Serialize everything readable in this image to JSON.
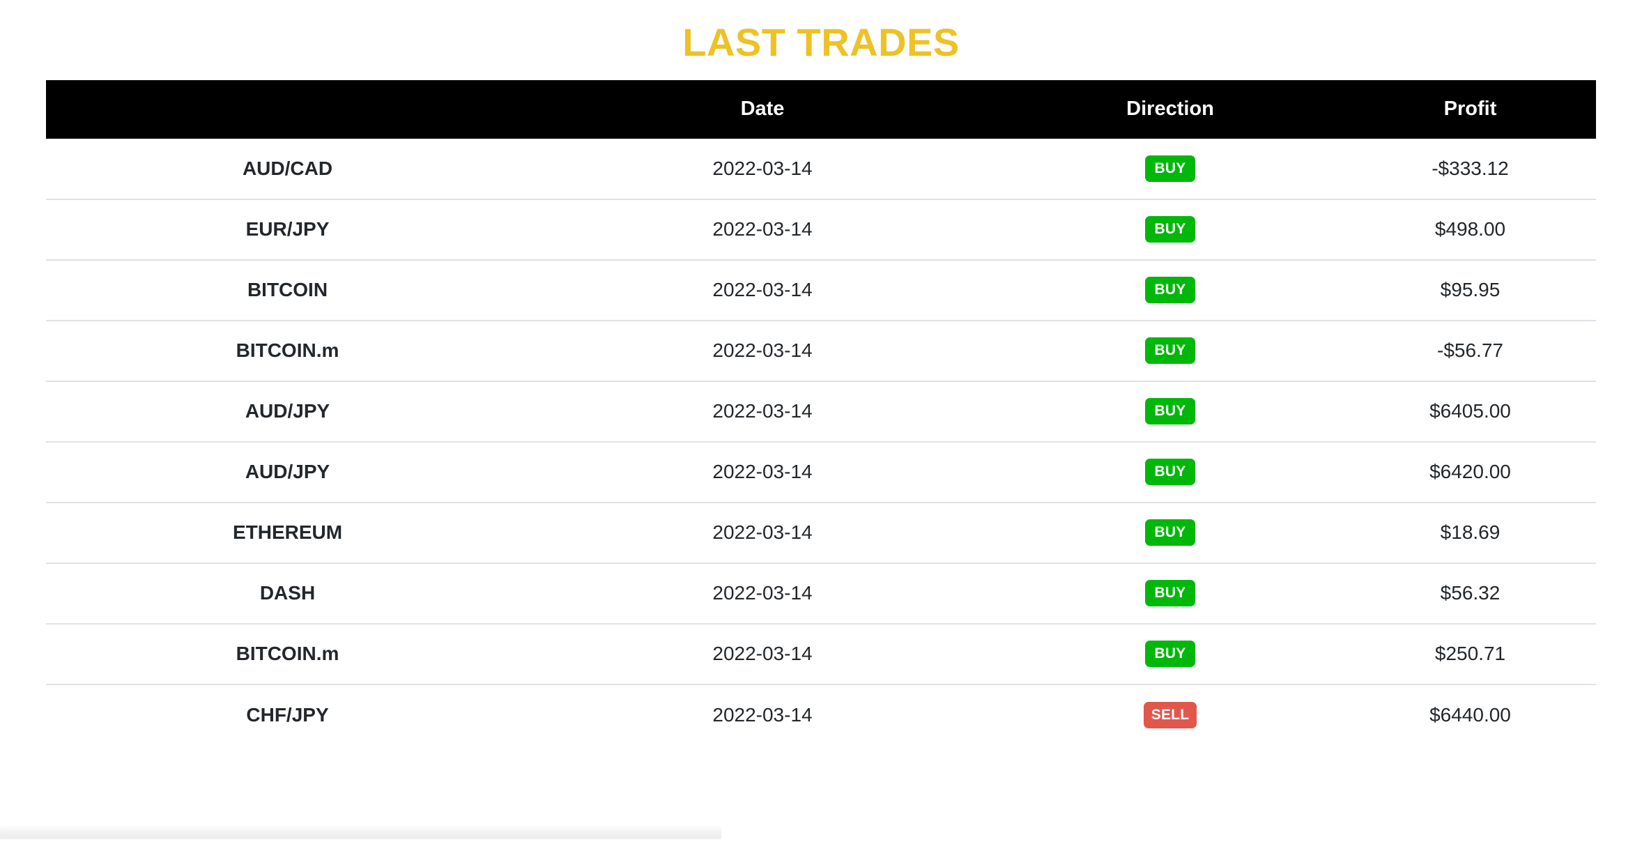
{
  "page": {
    "title": "LAST TRADES",
    "title_color": "#edc227",
    "background": "#ffffff"
  },
  "table": {
    "header_background": "#000000",
    "header_text_color": "#ffffff",
    "row_divider_color": "#dee2e6",
    "columns": [
      {
        "key": "symbol",
        "label": ""
      },
      {
        "key": "date",
        "label": "Date"
      },
      {
        "key": "direction",
        "label": "Direction"
      },
      {
        "key": "profit",
        "label": "Profit"
      }
    ],
    "badge_colors": {
      "buy": "#00b80a",
      "sell": "#e2574c"
    },
    "rows": [
      {
        "symbol": "AUD/CAD",
        "date": "2022-03-14",
        "direction": "BUY",
        "profit": "-$333.12"
      },
      {
        "symbol": "EUR/JPY",
        "date": "2022-03-14",
        "direction": "BUY",
        "profit": "$498.00"
      },
      {
        "symbol": "BITCOIN",
        "date": "2022-03-14",
        "direction": "BUY",
        "profit": "$95.95"
      },
      {
        "symbol": "BITCOIN.m",
        "date": "2022-03-14",
        "direction": "BUY",
        "profit": "-$56.77"
      },
      {
        "symbol": "AUD/JPY",
        "date": "2022-03-14",
        "direction": "BUY",
        "profit": "$6405.00"
      },
      {
        "symbol": "AUD/JPY",
        "date": "2022-03-14",
        "direction": "BUY",
        "profit": "$6420.00"
      },
      {
        "symbol": "ETHEREUM",
        "date": "2022-03-14",
        "direction": "BUY",
        "profit": "$18.69"
      },
      {
        "symbol": "DASH",
        "date": "2022-03-14",
        "direction": "BUY",
        "profit": "$56.32"
      },
      {
        "symbol": "BITCOIN.m",
        "date": "2022-03-14",
        "direction": "BUY",
        "profit": "$250.71"
      },
      {
        "symbol": "CHF/JPY",
        "date": "2022-03-14",
        "direction": "SELL",
        "profit": "$6440.00"
      }
    ]
  }
}
